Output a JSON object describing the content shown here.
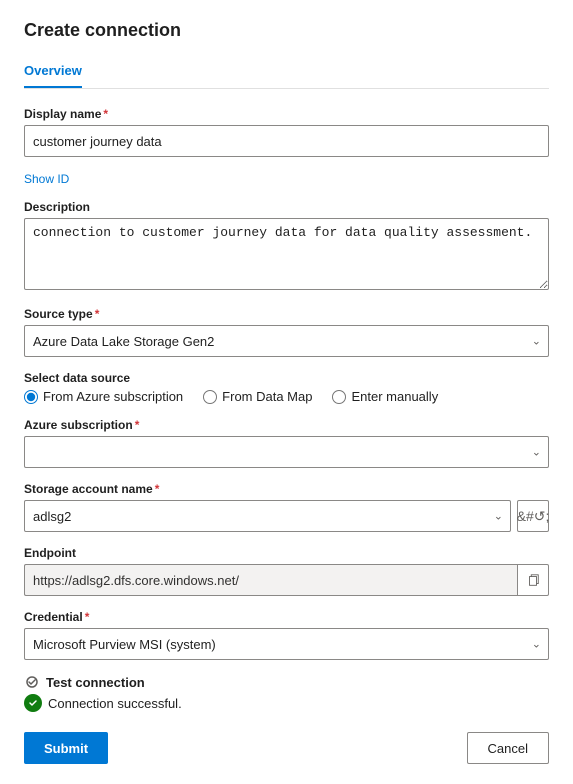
{
  "page": {
    "title": "Create connection",
    "tabs": [
      {
        "id": "overview",
        "label": "Overview",
        "active": true
      }
    ],
    "show_id_link": "Show ID",
    "fields": {
      "display_name": {
        "label": "Display name",
        "required": true,
        "value": "customer journey data",
        "placeholder": ""
      },
      "description": {
        "label": "Description",
        "required": false,
        "value": "connection to customer journey data for data quality assessment.",
        "placeholder": ""
      },
      "source_type": {
        "label": "Source type",
        "required": true,
        "value": "Azure Data Lake Storage Gen2",
        "options": [
          "Azure Data Lake Storage Gen2"
        ]
      },
      "select_data_source": {
        "label": "Select data source",
        "options": [
          {
            "id": "azure-subscription",
            "label": "From Azure subscription",
            "checked": true
          },
          {
            "id": "from-data-map",
            "label": "From Data Map",
            "checked": false
          },
          {
            "id": "enter-manually",
            "label": "Enter manually",
            "checked": false
          }
        ]
      },
      "azure_subscription": {
        "label": "Azure subscription",
        "required": true,
        "value": "",
        "placeholder": ""
      },
      "storage_account_name": {
        "label": "Storage account name",
        "required": true,
        "value": "adlsg2",
        "placeholder": ""
      },
      "endpoint": {
        "label": "Endpoint",
        "required": false,
        "value": "https://adlsg2.dfs.core.windows.net/"
      },
      "credential": {
        "label": "Credential",
        "required": true,
        "value": "Microsoft Purview MSI (system)",
        "options": [
          "Microsoft Purview MSI (system)"
        ]
      }
    },
    "test_connection": {
      "label": "Test connection",
      "status": "Connection successful."
    },
    "buttons": {
      "submit": "Submit",
      "cancel": "Cancel"
    }
  }
}
